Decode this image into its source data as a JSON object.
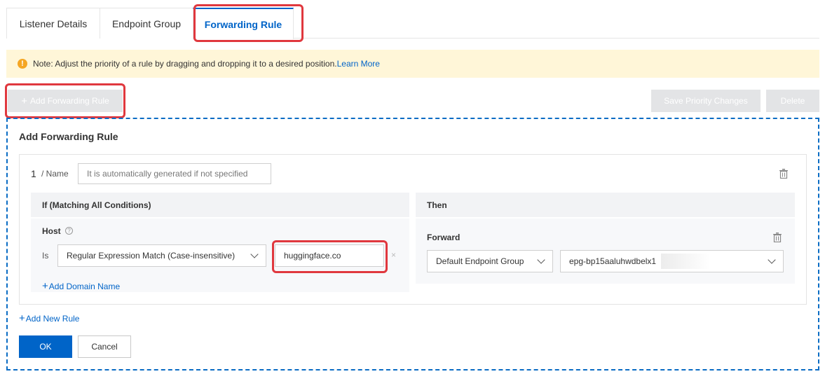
{
  "tabs": [
    {
      "label": "Listener Details"
    },
    {
      "label": "Endpoint Group"
    },
    {
      "label": "Forwarding Rule"
    }
  ],
  "note": {
    "text": "Note: Adjust the priority of a rule by dragging and dropping it to a desired position.",
    "link": "Learn More"
  },
  "toolbar": {
    "add_label": "Add Forwarding Rule",
    "save_label": "Save Priority Changes",
    "delete_label": "Delete"
  },
  "form": {
    "title": "Add Forwarding Rule",
    "rule": {
      "index": "1",
      "name_label": "/ Name",
      "name_placeholder": "It is automatically generated if not specified"
    },
    "if_panel": {
      "title": "If (Matching All Conditions)",
      "host_label": "Host",
      "is_label": "Is",
      "match_type": "Regular Expression Match (Case-insensitive)",
      "host_value": "huggingface.co",
      "add_domain_label": "Add Domain Name"
    },
    "then_panel": {
      "title": "Then",
      "forward_label": "Forward",
      "group_type": "Default Endpoint Group",
      "endpoint_group": "epg-bp15aaluhwdbelx1"
    },
    "add_rule_label": "Add New Rule",
    "ok_label": "OK",
    "cancel_label": "Cancel"
  },
  "colors": {
    "accent": "#0064c8",
    "highlight": "#e0383e",
    "note_bg": "#fff6d8"
  }
}
